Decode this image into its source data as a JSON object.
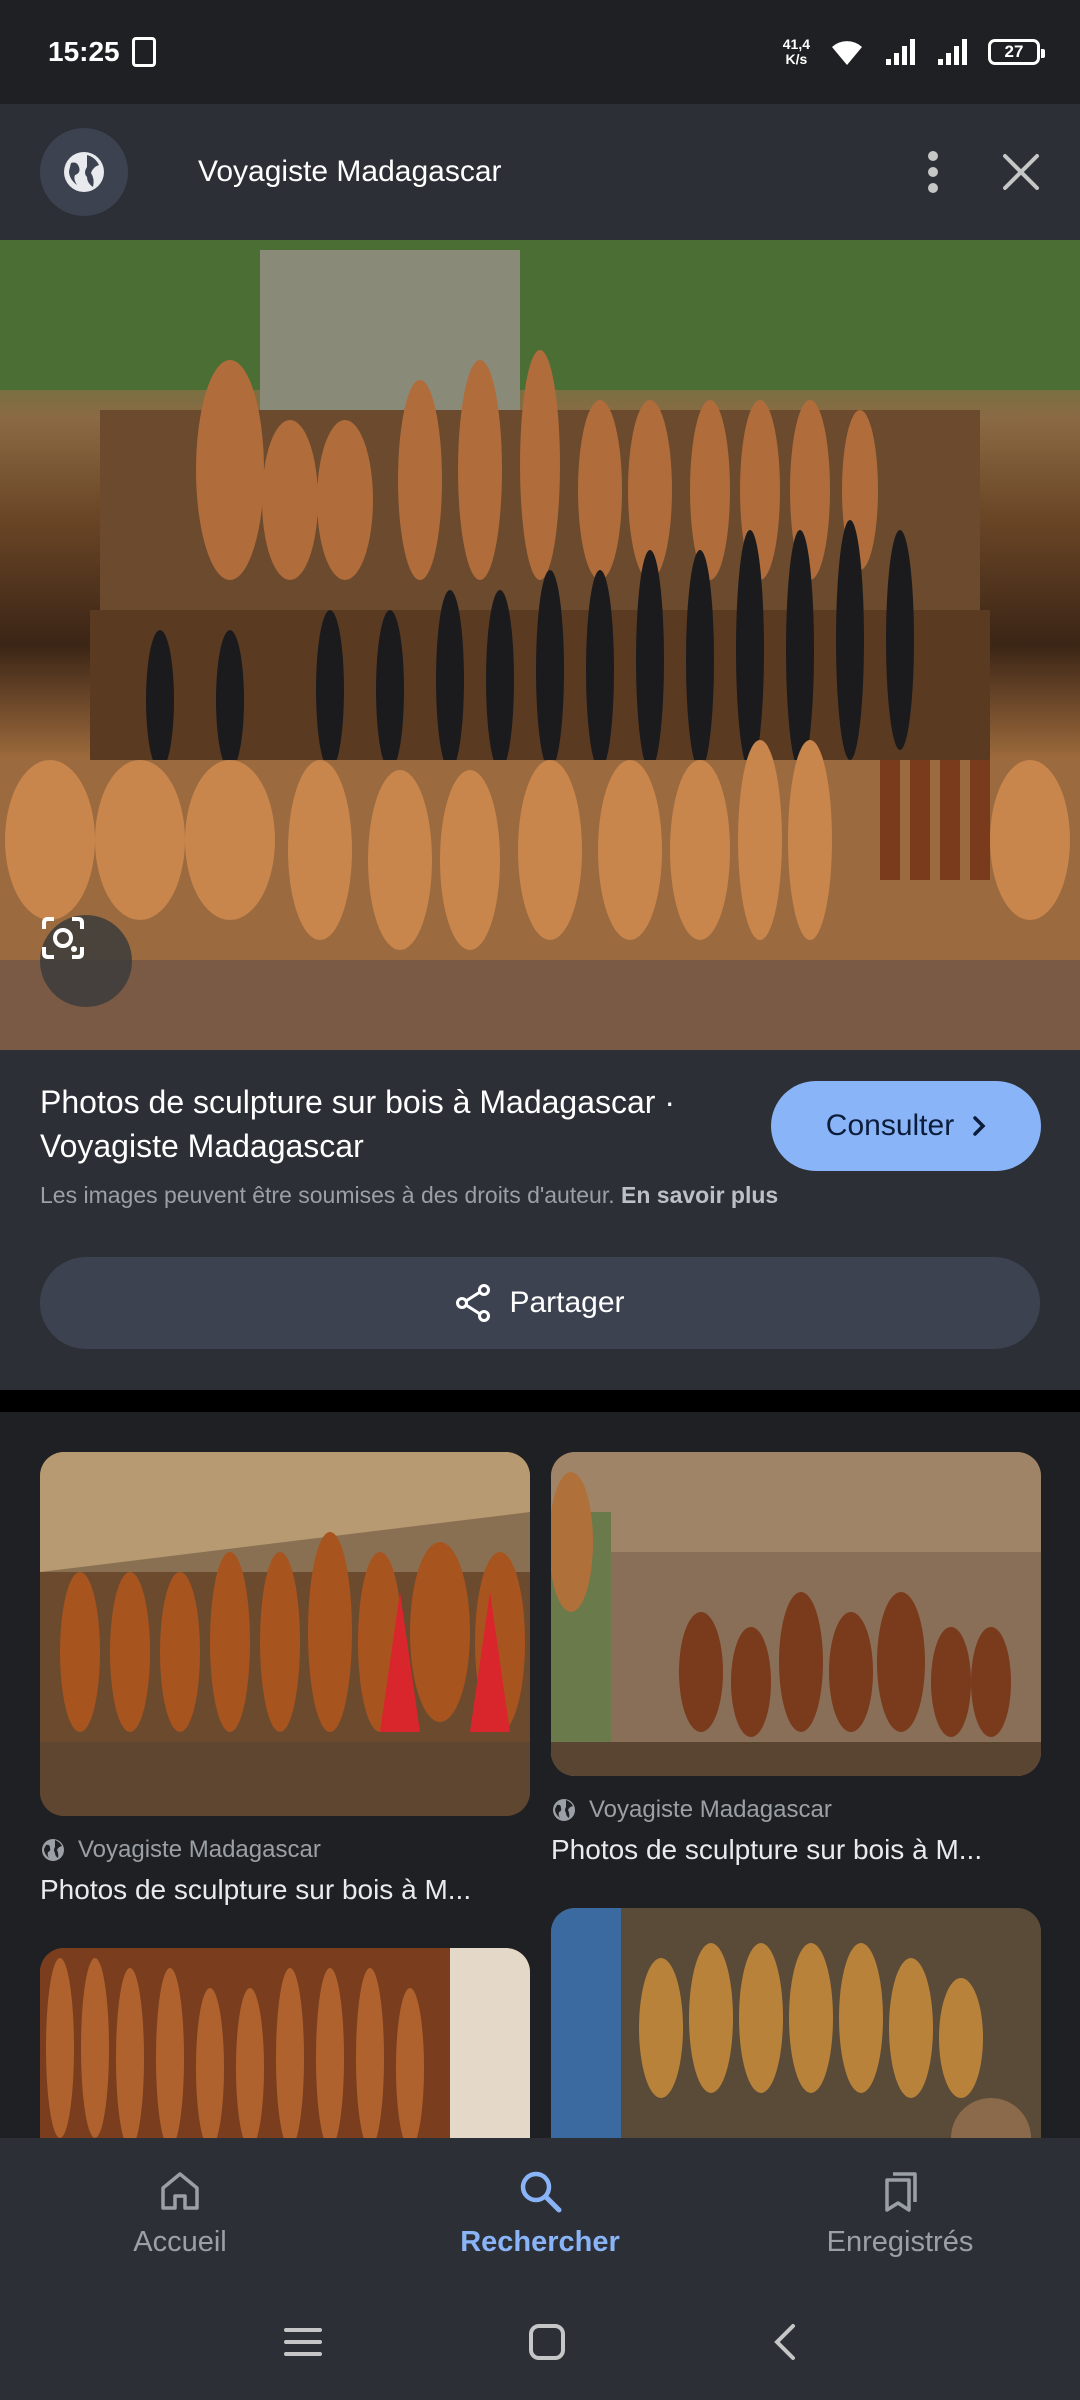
{
  "status_bar": {
    "time": "15:25",
    "net_speed_value": "41,4",
    "net_speed_unit": "K/s",
    "battery": "27"
  },
  "header": {
    "title": "Voyagiste Madagascar"
  },
  "hero": {
    "icon": "lens-icon"
  },
  "info": {
    "title": "Photos de sculpture sur bois à Madagascar · Voyagiste Madagascar",
    "consult_label": "Consulter",
    "copyright_text": "Les images peuvent être soumises à des droits d'auteur.",
    "learn_more": "En savoir plus",
    "share_label": "Partager"
  },
  "results": [
    {
      "source": "Voyagiste Madagascar",
      "title": "Photos de sculpture sur bois à M..."
    },
    {
      "source": "Voyagiste Madagascar",
      "title": "Photos de sculpture sur bois à M..."
    }
  ],
  "bottom_nav": {
    "items": [
      {
        "label": "Accueil",
        "icon": "home-icon"
      },
      {
        "label": "Rechercher",
        "icon": "search-icon",
        "active": true
      },
      {
        "label": "Enregistrés",
        "icon": "bookmarks-icon"
      }
    ]
  },
  "colors": {
    "accent": "#8ab4f8",
    "panel": "#2c2f36",
    "background": "#1f2023"
  }
}
